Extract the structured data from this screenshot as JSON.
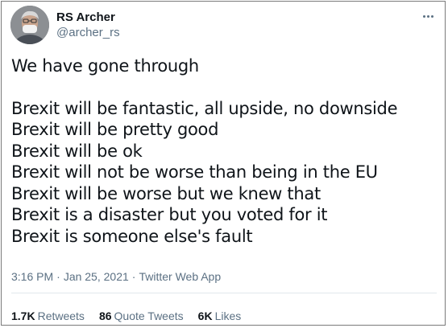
{
  "author": {
    "display_name": "RS Archer",
    "handle": "@archer_rs"
  },
  "tweet": {
    "intro": "We have gone through",
    "lines": [
      "Brexit will be fantastic, all upside, no downside",
      "Brexit will be pretty good",
      "Brexit will be ok",
      "Brexit will not be worse than being in the EU",
      "Brexit will be worse but we knew that",
      "Brexit is a disaster but you voted for it",
      "Brexit is someone else's fault"
    ],
    "time": "3:16 PM",
    "date": "Jan 25, 2021",
    "source": "Twitter Web App",
    "separator": "·"
  },
  "stats": {
    "retweets_count": "1.7K",
    "retweets_label": "Retweets",
    "quotes_count": "86",
    "quotes_label": "Quote Tweets",
    "likes_count": "6K",
    "likes_label": "Likes"
  },
  "icons": {
    "more": "more-options-icon"
  },
  "colors": {
    "text": "#0f1419",
    "secondary": "#5b7083",
    "border": "#7a7a7a"
  }
}
